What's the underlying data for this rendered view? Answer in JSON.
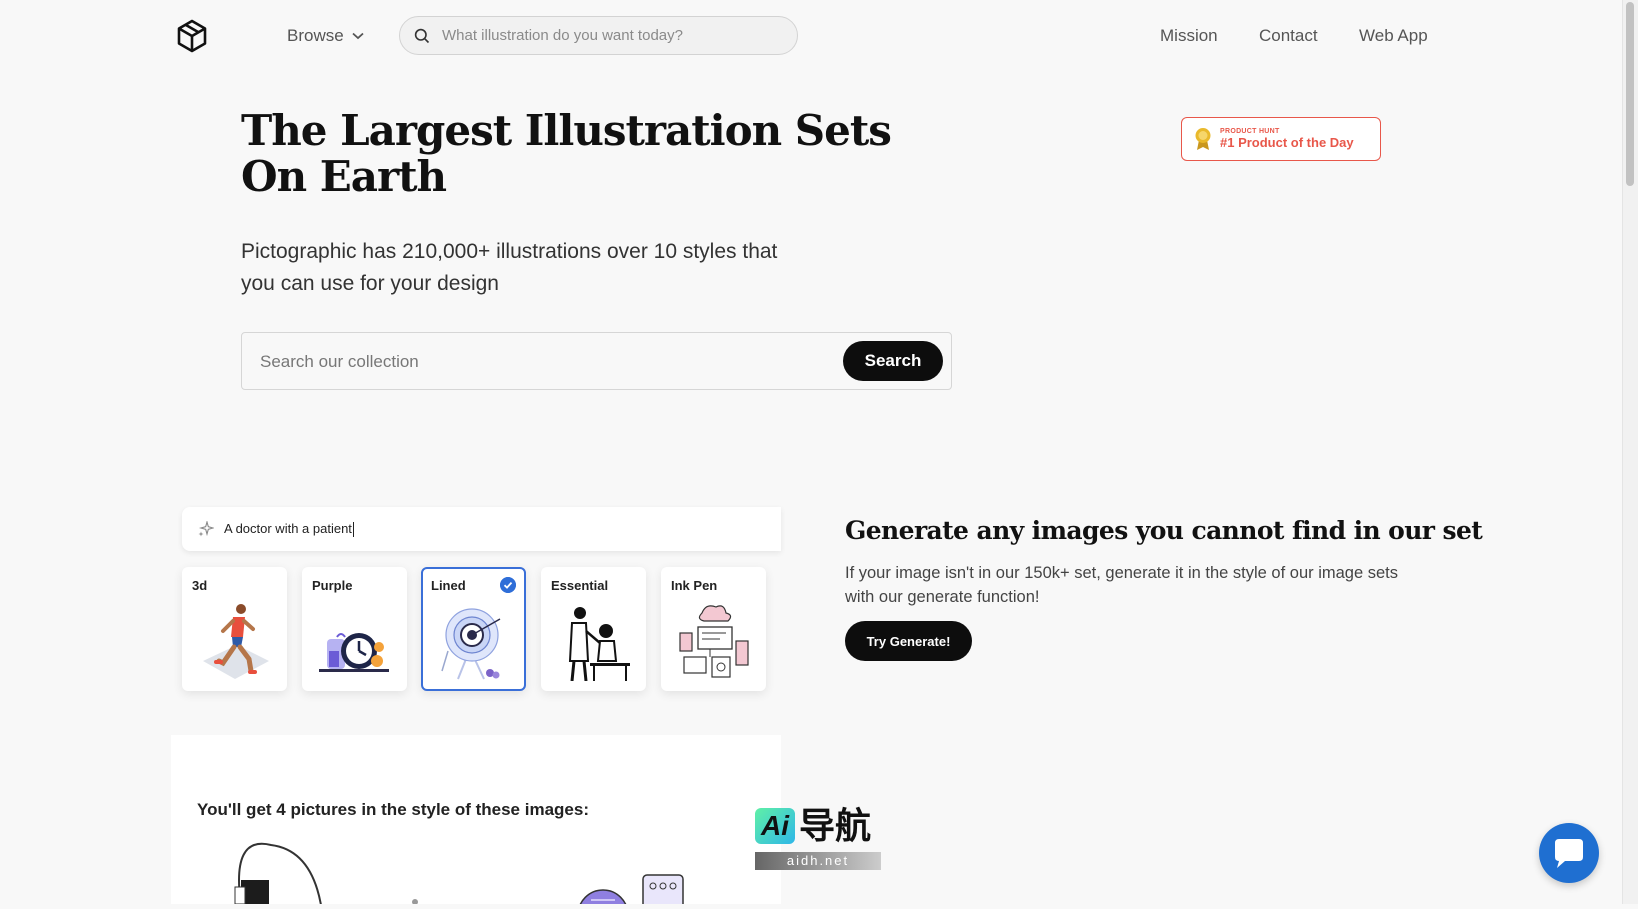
{
  "header": {
    "browse_label": "Browse",
    "search_placeholder": "What illustration do you want today?",
    "nav": [
      "Mission",
      "Contact",
      "Web App"
    ]
  },
  "hero": {
    "title": "The Largest Illustration Sets On Earth",
    "subtitle": "Pictographic has 210,000+ illustrations over 10 styles that you can use for your design",
    "search_placeholder": "Search our collection",
    "search_button": "Search"
  },
  "badge": {
    "small": "PRODUCT HUNT",
    "big": "#1 Product of the Day"
  },
  "demo": {
    "prompt": "A doctor with a patient",
    "styles": [
      {
        "label": "3d",
        "selected": false
      },
      {
        "label": "Purple",
        "selected": false
      },
      {
        "label": "Lined",
        "selected": true
      },
      {
        "label": "Essential",
        "selected": false
      },
      {
        "label": "Ink Pen",
        "selected": false
      }
    ],
    "result_text": "You'll get 4 pictures in the style of these images:"
  },
  "generate": {
    "title": "Generate any images you cannot find in our set",
    "text": "If your image isn't in our 150k+ set, generate it in the style of our image sets with our generate function!",
    "button": "Try Generate!"
  },
  "watermark": {
    "badge": "Ai",
    "name": "导航",
    "url": "aidh.net"
  },
  "colors": {
    "accent": "#0d0d0d",
    "selection": "#3a6fd8",
    "badge": "#e8574a",
    "chat": "#1f6fd1"
  },
  "icons": [
    "logo-icon",
    "chevron-down-icon",
    "search-icon",
    "award-icon",
    "sparkle-icon",
    "check-icon",
    "chat-icon"
  ]
}
